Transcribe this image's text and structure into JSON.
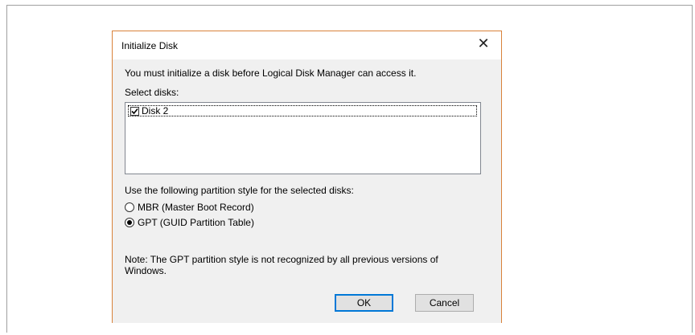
{
  "dialog": {
    "title": "Initialize Disk",
    "intro": "You must initialize a disk before Logical Disk Manager can access it.",
    "select_label": "Select disks:",
    "disks": [
      {
        "label": "Disk 2",
        "checked": true
      }
    ],
    "partition_label": "Use the following partition style for the selected disks:",
    "options": [
      {
        "label": "MBR (Master Boot Record)",
        "selected": false
      },
      {
        "label": "GPT (GUID Partition Table)",
        "selected": true
      }
    ],
    "note": "Note: The GPT partition style is not recognized by all previous versions of Windows.",
    "ok_label": "OK",
    "cancel_label": "Cancel"
  },
  "colors": {
    "dialog_border": "#d9823a",
    "default_button_border": "#0078d7",
    "dialog_background": "#f0f0f0"
  },
  "icons": {
    "close": "close-icon",
    "checkbox": "checkmark-icon"
  }
}
